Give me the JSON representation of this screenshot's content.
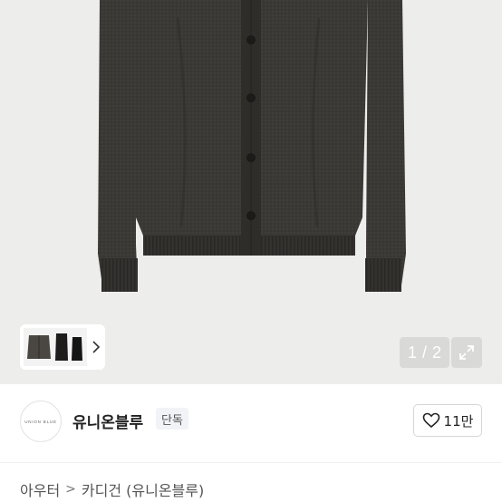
{
  "gallery": {
    "current_page": "1",
    "separator": "/",
    "total_pages": "2",
    "thumbnail_icon": "thumbnail-preview",
    "next_icon": "chevron-right-icon",
    "expand_icon": "expand-arrows-icon",
    "background_color": "#ededec",
    "garment_color": "#3b3935"
  },
  "brand": {
    "logo_text": "UNION BLUE",
    "name": "유니온블루",
    "badge": "단독"
  },
  "like": {
    "icon": "heart-outline-icon",
    "count": "11만"
  },
  "breadcrumb": {
    "category": "아우터",
    "separator": ">",
    "subcategory": "카디건 (유니온블루)"
  }
}
